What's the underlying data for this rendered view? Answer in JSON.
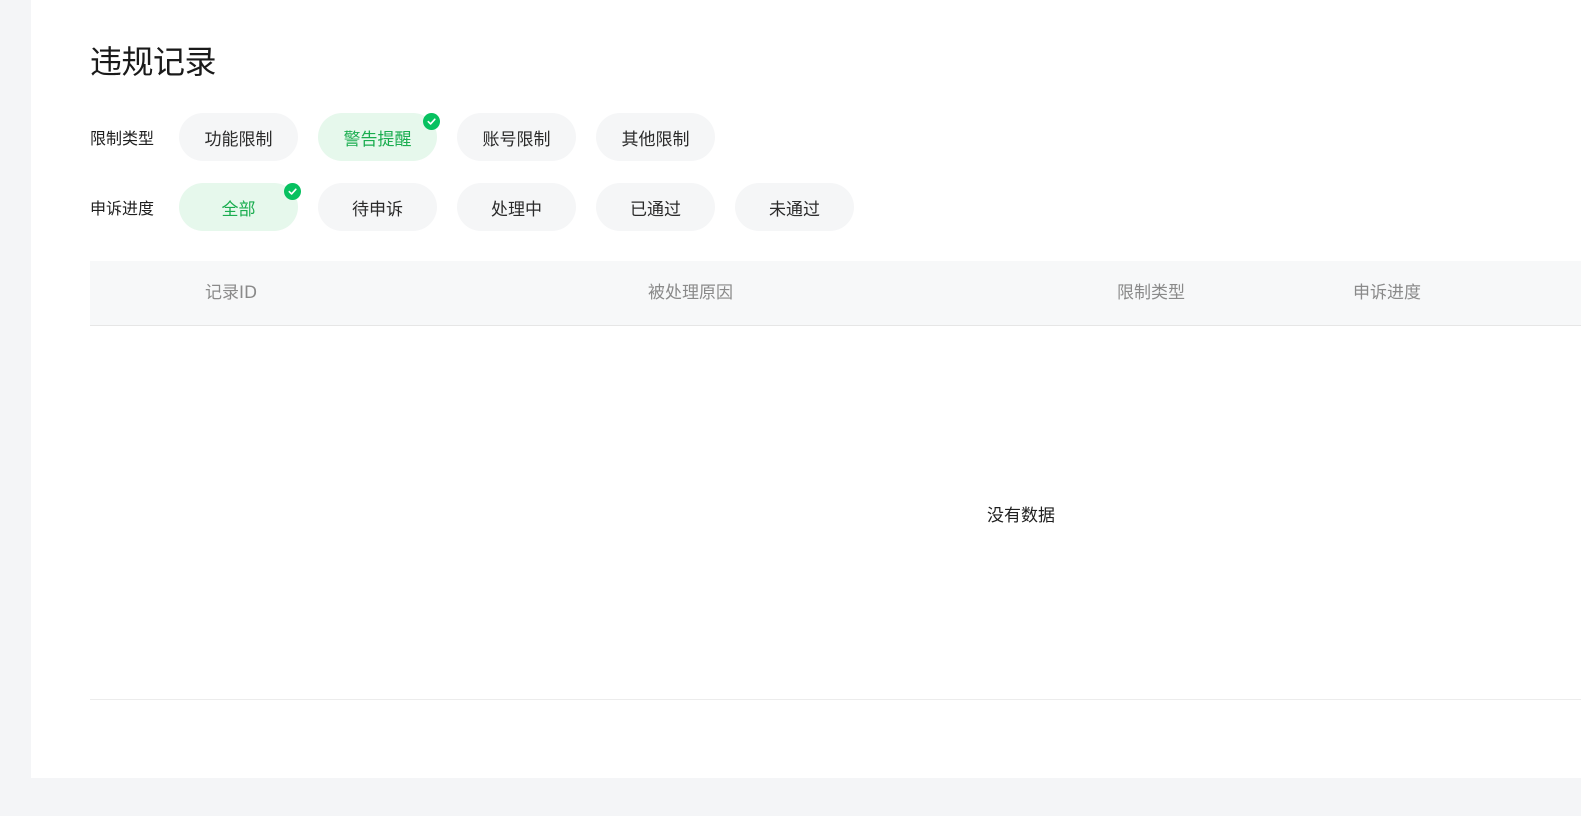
{
  "page": {
    "title": "违规记录"
  },
  "filters": {
    "restriction_type": {
      "label": "限制类型",
      "options": [
        {
          "label": "功能限制",
          "active": false
        },
        {
          "label": "警告提醒",
          "active": true
        },
        {
          "label": "账号限制",
          "active": false
        },
        {
          "label": "其他限制",
          "active": false
        }
      ]
    },
    "appeal_progress": {
      "label": "申诉进度",
      "options": [
        {
          "label": "全部",
          "active": true
        },
        {
          "label": "待申诉",
          "active": false
        },
        {
          "label": "处理中",
          "active": false
        },
        {
          "label": "已通过",
          "active": false
        },
        {
          "label": "未通过",
          "active": false
        }
      ]
    }
  },
  "table": {
    "columns": [
      "记录ID",
      "被处理原因",
      "限制类型",
      "申诉进度"
    ],
    "rows": [],
    "empty_text": "没有数据"
  },
  "colors": {
    "accent": "#07c160",
    "active_chip_bg": "#e6f8ec",
    "active_chip_text": "#1aad4f",
    "chip_bg": "#f5f6f7",
    "page_bg": "#f4f5f7"
  },
  "icons": {
    "selected": "check-circle-icon"
  }
}
